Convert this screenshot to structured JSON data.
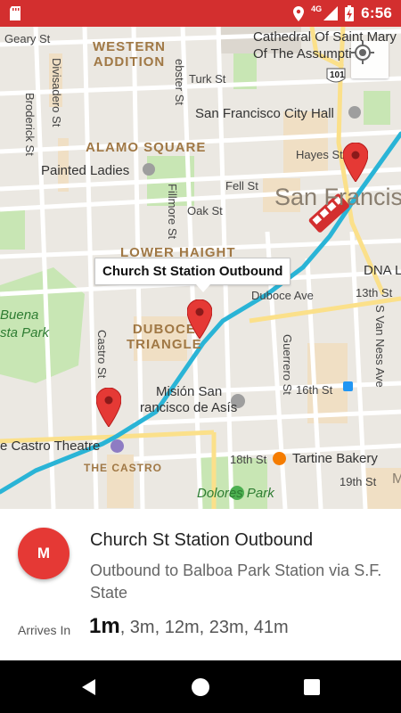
{
  "status_bar": {
    "network": "4G",
    "time": "6:56",
    "color": "#d32f2f"
  },
  "map": {
    "labels": {
      "geary": "Geary St",
      "western_addition": "WESTERN\nADDITION",
      "cathedral": "Cathedral Of Saint Mary\nOf The Assumption",
      "turk": "Turk St",
      "city_hall": "San Francisco City Hall",
      "alamo_square": "ALAMO SQUARE",
      "painted_ladies": "Painted Ladies",
      "hayes": "Hayes St",
      "fell": "Fell St",
      "oak": "Oak St",
      "san_francisco": "San Francis",
      "lower_haight": "LOWER HAIGHT",
      "duboce_ave": "Duboce Ave",
      "thirteenth": "13th St",
      "dna_lounge": "DNA L",
      "duboce_triangle": "DUBOCE\nTRIANGLE",
      "buena": "Buena",
      "vista_park": "sta Park",
      "mision": "Misión San",
      "francisco_asis": "rancisco de Asís",
      "sixteenth": "16th St",
      "castro_theatre": "e Castro Theatre",
      "the_castro": "THE CASTRO",
      "eighteenth": "18th St",
      "tartine": "Tartine Bakery",
      "nineteenth": "19th St",
      "dolores_park": "Dolores Park",
      "divisadero": "Divisadero St",
      "broderick": "Broderick St",
      "fillmore": "Fillmore St",
      "webster": "ebster St",
      "castro_st": "Castro St",
      "guerrero": "Guerrero St",
      "van_ness": "S Van Ness Ave",
      "highway": "101",
      "m_letter": "M"
    },
    "info_window": "Church St Station Outbound",
    "route_color": "#2ab4d6",
    "pin_color": "#e53935"
  },
  "card": {
    "badge": "M",
    "badge_color": "#e53935",
    "title": "Church St Station Outbound",
    "subtitle": "Outbound to Balboa Park Station via S.F. State",
    "arrives_label": "Arrives In",
    "arrivals_first": "1m",
    "arrivals_rest": ", 3m, 12m, 23m, 41m"
  },
  "nav_bar": {
    "icons": [
      "back-icon",
      "home-icon",
      "recents-icon"
    ]
  }
}
